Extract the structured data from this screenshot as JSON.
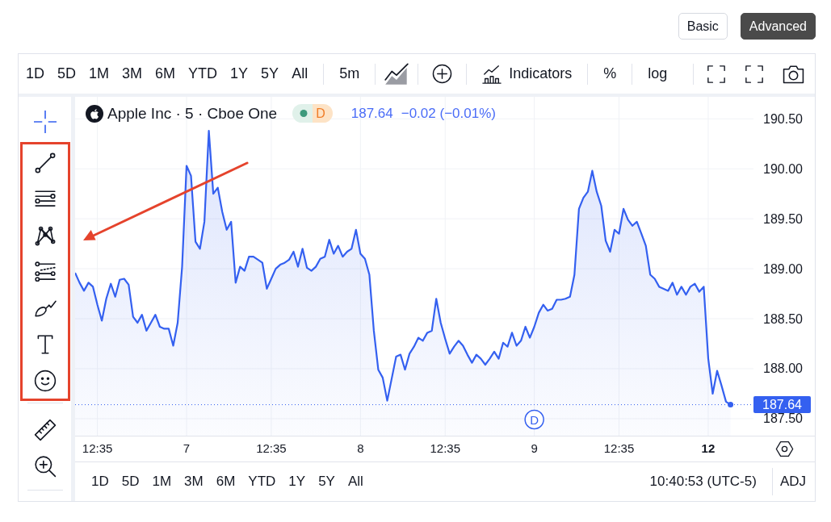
{
  "mode_buttons": [
    {
      "label": "Basic",
      "selected": false
    },
    {
      "label": "Advanced",
      "selected": true
    }
  ],
  "toolbar": {
    "ranges": [
      "1D",
      "5D",
      "1M",
      "3M",
      "6M",
      "YTD",
      "1Y",
      "5Y",
      "All"
    ],
    "interval": "5m",
    "indicators": "Indicators",
    "percent": "%",
    "log": "log"
  },
  "left_toolbar": {
    "groups": [
      {
        "highlighted": false,
        "tools": [
          {
            "kind": "crosshair",
            "selected": true
          }
        ]
      },
      {
        "highlighted": true,
        "tools": [
          {
            "kind": "trend-line",
            "selected": false
          },
          {
            "kind": "horizontal-lines",
            "selected": false
          },
          {
            "kind": "pattern",
            "selected": false
          },
          {
            "kind": "channel",
            "selected": false
          },
          {
            "kind": "brush",
            "selected": false
          },
          {
            "kind": "text",
            "selected": false
          },
          {
            "kind": "emoji",
            "selected": false
          }
        ]
      },
      {
        "highlighted": false,
        "tools": [
          {
            "kind": "ruler",
            "selected": false
          },
          {
            "kind": "zoom-in",
            "selected": false
          }
        ]
      }
    ]
  },
  "chart": {
    "legend": {
      "title": "Apple Inc · 5 · Cboe One",
      "badge": "D",
      "price": "187.64",
      "change": "−0.02 (−0.01%)"
    },
    "chart_data": {
      "type": "area",
      "categories": [
        null,
        null,
        null,
        null,
        null,
        "12:35",
        null,
        null,
        null,
        null,
        null,
        null,
        null,
        null,
        null,
        null,
        null,
        null,
        null,
        null,
        null,
        null,
        null,
        null,
        null,
        "7",
        null,
        null,
        null,
        null,
        null,
        null,
        null,
        null,
        null,
        null,
        null,
        null,
        null,
        null,
        null,
        null,
        null,
        null,
        "12:35",
        null,
        null,
        null,
        null,
        null,
        null,
        null,
        null,
        null,
        null,
        null,
        null,
        null,
        null,
        null,
        null,
        null,
        null,
        null,
        "8",
        null,
        null,
        null,
        null,
        null,
        null,
        null,
        null,
        null,
        null,
        null,
        null,
        null,
        null,
        null,
        null,
        null,
        null,
        "12:35",
        null,
        null,
        null,
        null,
        null,
        null,
        null,
        null,
        null,
        null,
        null,
        null,
        null,
        null,
        null,
        null,
        null,
        null,
        null,
        "9",
        null,
        null,
        null,
        null,
        null,
        null,
        null,
        null,
        null,
        null,
        null,
        null,
        null,
        null,
        null,
        null,
        null,
        null,
        "12:35",
        null,
        null,
        null,
        null,
        null,
        null,
        null,
        null,
        null,
        null,
        null,
        null,
        null,
        null,
        null,
        null,
        null,
        null,
        null,
        "**12**",
        null,
        null,
        null,
        null,
        null
      ],
      "values": [
        188.96,
        188.86,
        188.78,
        188.86,
        188.82,
        188.64,
        188.48,
        188.7,
        188.85,
        188.72,
        188.89,
        188.9,
        188.84,
        188.52,
        188.46,
        188.54,
        188.38,
        188.46,
        188.54,
        188.42,
        188.4,
        188.4,
        188.23,
        188.46,
        189.02,
        190.03,
        189.93,
        189.27,
        189.2,
        189.47,
        190.38,
        189.75,
        189.81,
        189.57,
        189.39,
        189.47,
        188.86,
        189.02,
        188.98,
        189.12,
        189.12,
        189.09,
        189.06,
        188.8,
        188.9,
        189.0,
        189.04,
        189.06,
        189.09,
        189.17,
        189.02,
        189.2,
        189.01,
        188.98,
        189.02,
        189.1,
        189.12,
        189.29,
        189.15,
        189.23,
        189.12,
        189.17,
        189.2,
        189.39,
        189.15,
        189.1,
        188.94,
        188.38,
        187.99,
        187.91,
        187.68,
        187.9,
        188.12,
        188.14,
        187.99,
        188.15,
        188.22,
        188.31,
        188.28,
        188.36,
        188.38,
        188.7,
        188.46,
        188.3,
        188.15,
        188.22,
        188.28,
        188.23,
        188.14,
        188.06,
        188.14,
        188.1,
        188.04,
        188.1,
        188.17,
        188.1,
        188.26,
        188.22,
        188.36,
        188.23,
        188.28,
        188.42,
        188.31,
        188.42,
        188.56,
        188.64,
        188.58,
        188.6,
        188.69,
        188.69,
        188.7,
        188.72,
        188.94,
        189.6,
        189.71,
        189.77,
        189.98,
        189.77,
        189.63,
        189.28,
        189.17,
        189.39,
        189.35,
        189.6,
        189.49,
        189.43,
        189.47,
        189.35,
        189.23,
        188.94,
        188.9,
        188.82,
        188.8,
        188.78,
        188.86,
        188.74,
        188.82,
        188.74,
        188.82,
        188.85,
        188.77,
        188.82,
        188.1,
        187.75,
        187.98,
        187.83,
        187.67,
        187.64
      ],
      "ylim": [
        187.33,
        190.72
      ],
      "yticks": [
        {
          "value": 190.5,
          "label": "190.50"
        },
        {
          "value": 190.0,
          "label": "190.00"
        },
        {
          "value": 189.5,
          "label": "189.50"
        },
        {
          "value": 189.0,
          "label": "189.00"
        },
        {
          "value": 188.5,
          "label": "188.50"
        },
        {
          "value": 188.0,
          "label": "188.00"
        },
        {
          "value": 187.5,
          "label": "187.50"
        }
      ],
      "grid": true,
      "ref_lines": [
        {
          "axis": "y",
          "value": 187.64,
          "label": "187.64"
        }
      ],
      "annotations": [
        {
          "x": "9",
          "text": "D"
        }
      ]
    }
  },
  "bottom_bar": {
    "ranges": [
      "1D",
      "5D",
      "1M",
      "3M",
      "6M",
      "YTD",
      "1Y",
      "5Y",
      "All"
    ],
    "clock": "10:40:53 (UTC-5)",
    "adjust": "ADJ"
  }
}
